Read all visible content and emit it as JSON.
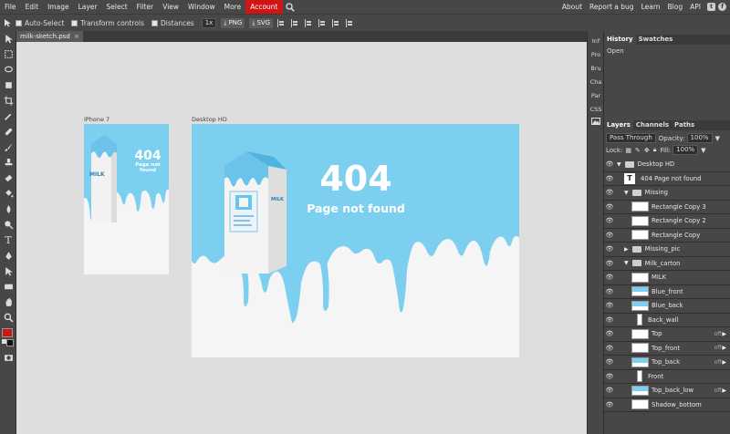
{
  "menu": {
    "items": [
      "File",
      "Edit",
      "Image",
      "Layer",
      "Select",
      "Filter",
      "View",
      "Window",
      "More"
    ],
    "active": "Account",
    "right": [
      "About",
      "Report a bug",
      "Learn",
      "Blog",
      "API"
    ]
  },
  "options": {
    "auto_select": "Auto-Select",
    "transform": "Transform controls",
    "distances": "Distances",
    "scale": "1x",
    "png": "PNG",
    "svg": "SVG"
  },
  "document": {
    "tab": "milk-sketch.psd",
    "close": "×"
  },
  "canvas": {
    "artboards": [
      {
        "label": "iPhone 7",
        "title": "404",
        "subtitle": "Page not found",
        "carton_text": "MILK"
      },
      {
        "label": "Desktop HD",
        "title": "404",
        "subtitle": "Page not found",
        "carton_text": "MILK"
      }
    ]
  },
  "mini_panel": [
    "Inf",
    "Pro",
    "Bru",
    "Cha",
    "Par",
    "CSS"
  ],
  "history": {
    "tabs": [
      "History",
      "Swatches"
    ],
    "items": [
      "Open"
    ]
  },
  "layers": {
    "tabs": [
      "Layers",
      "Channels",
      "Paths"
    ],
    "blend": "Pass Through",
    "opacity_label": "Opacity:",
    "opacity": "100%",
    "lock_label": "Lock:",
    "fill_label": "Fill:",
    "fill": "100%",
    "rows": [
      {
        "name": "Desktop HD",
        "kind": "folder",
        "indent": 0
      },
      {
        "name": "404 Page not found",
        "kind": "text",
        "indent": 1
      },
      {
        "name": "Missing",
        "kind": "folder",
        "indent": 1
      },
      {
        "name": "Rectangle Copy 3",
        "kind": "thumb",
        "indent": 2
      },
      {
        "name": "Rectangle Copy 2",
        "kind": "thumb",
        "indent": 2
      },
      {
        "name": "Rectangle Copy",
        "kind": "thumb",
        "indent": 2
      },
      {
        "name": "Missing_pic",
        "kind": "folder-closed",
        "indent": 1
      },
      {
        "name": "Milk_carton",
        "kind": "folder",
        "indent": 1
      },
      {
        "name": "MILK",
        "kind": "thumb",
        "indent": 2
      },
      {
        "name": "Blue_front",
        "kind": "blue",
        "indent": 2
      },
      {
        "name": "Blue_back",
        "kind": "blue",
        "indent": 2
      },
      {
        "name": "Back_wall",
        "kind": "tall",
        "indent": 2
      },
      {
        "name": "Top",
        "kind": "thumb",
        "indent": 2,
        "off": "off"
      },
      {
        "name": "Top_front",
        "kind": "thumb",
        "indent": 2,
        "off": "off"
      },
      {
        "name": "Top_back",
        "kind": "blue",
        "indent": 2,
        "off": "off"
      },
      {
        "name": "Front",
        "kind": "tall",
        "indent": 2
      },
      {
        "name": "Top_back_low",
        "kind": "blue",
        "indent": 2,
        "off": "off"
      },
      {
        "name": "Shadow_bottom",
        "kind": "thumb",
        "indent": 2
      }
    ]
  },
  "colors": {
    "accent": "#d11515",
    "sky": "#7dcff0",
    "panel": "#474747"
  }
}
